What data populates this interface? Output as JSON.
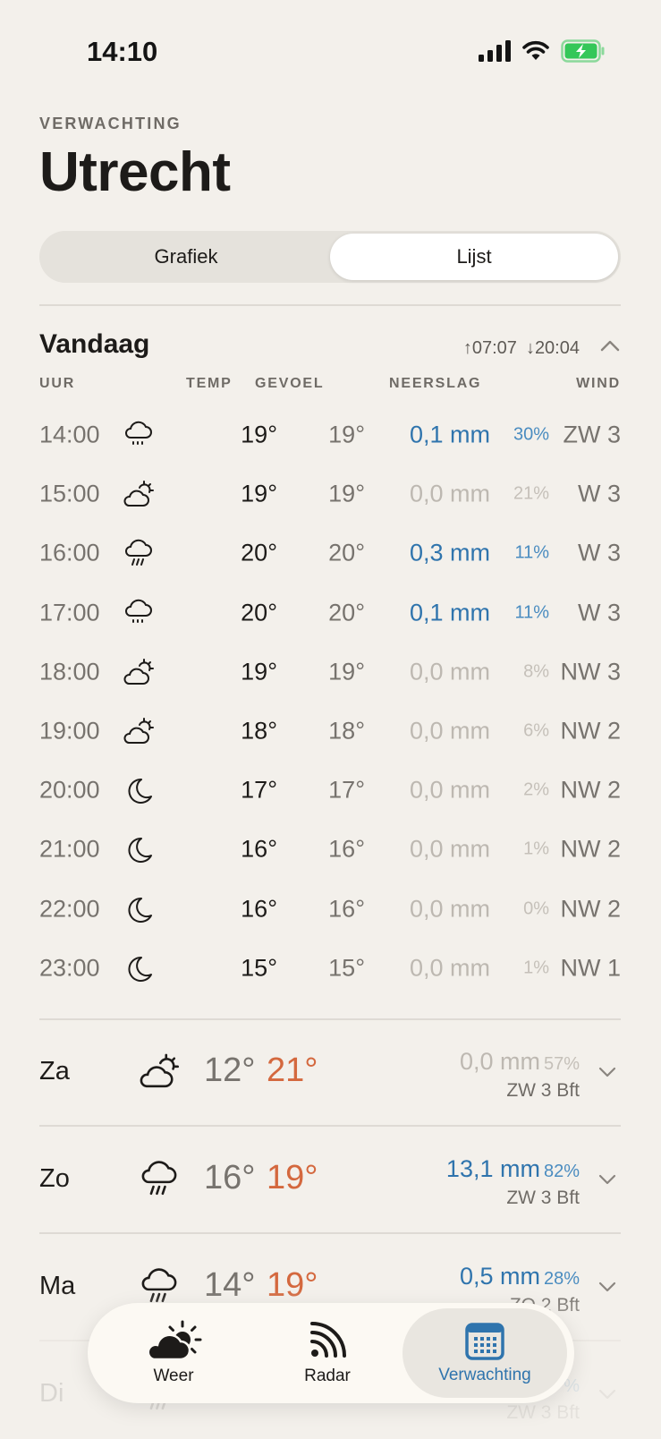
{
  "status_bar": {
    "time": "14:10"
  },
  "header": {
    "eyebrow": "VERWACHTING",
    "city": "Utrecht"
  },
  "view_toggle": {
    "options": [
      "Grafiek",
      "Lijst"
    ],
    "selected": "Lijst"
  },
  "today": {
    "title": "Vandaag",
    "sunrise": "07:07",
    "sunset": "20:04",
    "columns": [
      "UUR",
      "TEMP",
      "GEVOEL",
      "NEERSLAG",
      "WIND"
    ],
    "hours": [
      {
        "time": "14:00",
        "icon": "cloud-drizzle-icon",
        "temp": "19°",
        "feel": "19°",
        "mm": "0,1 mm",
        "pct": "30%",
        "wind": "ZW 3",
        "wet": true
      },
      {
        "time": "15:00",
        "icon": "partly-cloudy-icon",
        "temp": "19°",
        "feel": "19°",
        "mm": "0,0 mm",
        "pct": "21%",
        "wind": "W 3",
        "wet": false
      },
      {
        "time": "16:00",
        "icon": "cloud-rain-icon",
        "temp": "20°",
        "feel": "20°",
        "mm": "0,3 mm",
        "pct": "11%",
        "wind": "W 3",
        "wet": true
      },
      {
        "time": "17:00",
        "icon": "cloud-drizzle-icon",
        "temp": "20°",
        "feel": "20°",
        "mm": "0,1 mm",
        "pct": "11%",
        "wind": "W 3",
        "wet": true
      },
      {
        "time": "18:00",
        "icon": "partly-cloudy-icon",
        "temp": "19°",
        "feel": "19°",
        "mm": "0,0 mm",
        "pct": "8%",
        "wind": "NW 3",
        "wet": false
      },
      {
        "time": "19:00",
        "icon": "partly-cloudy-icon",
        "temp": "18°",
        "feel": "18°",
        "mm": "0,0 mm",
        "pct": "6%",
        "wind": "NW 2",
        "wet": false
      },
      {
        "time": "20:00",
        "icon": "moon-icon",
        "temp": "17°",
        "feel": "17°",
        "mm": "0,0 mm",
        "pct": "2%",
        "wind": "NW 2",
        "wet": false
      },
      {
        "time": "21:00",
        "icon": "moon-icon",
        "temp": "16°",
        "feel": "16°",
        "mm": "0,0 mm",
        "pct": "1%",
        "wind": "NW 2",
        "wet": false
      },
      {
        "time": "22:00",
        "icon": "moon-icon",
        "temp": "16°",
        "feel": "16°",
        "mm": "0,0 mm",
        "pct": "0%",
        "wind": "NW 2",
        "wet": false
      },
      {
        "time": "23:00",
        "icon": "moon-icon",
        "temp": "15°",
        "feel": "15°",
        "mm": "0,0 mm",
        "pct": "1%",
        "wind": "NW 1",
        "wet": false
      }
    ]
  },
  "days": [
    {
      "name": "Za",
      "icon": "partly-cloudy-icon",
      "low": "12°",
      "high": "21°",
      "mm": "0,0 mm",
      "pct": "57%",
      "wind": "ZW 3 Bft",
      "wet": false
    },
    {
      "name": "Zo",
      "icon": "cloud-rain-icon",
      "low": "16°",
      "high": "19°",
      "mm": "13,1 mm",
      "pct": "82%",
      "wind": "ZW 3 Bft",
      "wet": true
    },
    {
      "name": "Ma",
      "icon": "cloud-rain-icon",
      "low": "14°",
      "high": "19°",
      "mm": "0,5 mm",
      "pct": "28%",
      "wind": "ZO 2 Bft",
      "wet": true
    },
    {
      "name": "Di",
      "icon": "cloud-rain-icon",
      "low": "",
      "high": "",
      "mm": "",
      "pct": "%",
      "wind": "ZW 3 Bft",
      "wet": true
    }
  ],
  "tabbar": {
    "items": [
      {
        "label": "Weer",
        "icon": "sun-cloud-icon"
      },
      {
        "label": "Radar",
        "icon": "radar-icon"
      },
      {
        "label": "Verwachting",
        "icon": "calendar-icon"
      }
    ],
    "selected": "Verwachting"
  },
  "colors": {
    "background": "#f3f0eb",
    "rain_blue": "#2f74ad",
    "high_temp": "#d4683e",
    "battery_green": "#34c759"
  }
}
